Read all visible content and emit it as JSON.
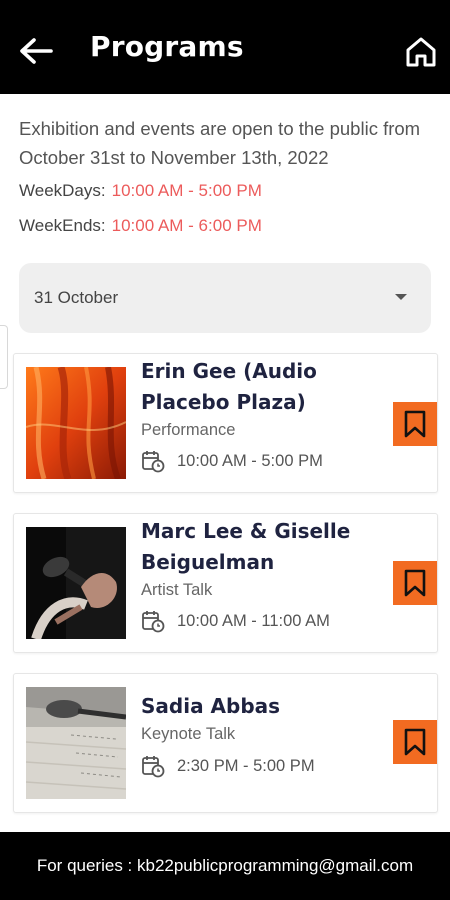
{
  "header": {
    "title": "Programs",
    "back_icon": "arrow-left-icon",
    "home_icon": "home-icon",
    "background": "#000000"
  },
  "intro": {
    "text": "Exhibition and events are open to the public from October 31st to November 13th, 2022",
    "weekdays_label": "WeekDays:",
    "weekdays_hours": "10:00 AM - 5:00 PM",
    "weekends_label": "WeekEnds:",
    "weekends_hours": "10:00 AM - 6:00 PM",
    "hours_color": "#ec5b5b"
  },
  "date_filter": {
    "selected": "31 October",
    "icon": "caret-down-icon"
  },
  "programs": [
    {
      "name": "Erin Gee (Audio Placebo Plaza)",
      "type": "Performance",
      "time": "10:00 AM - 5:00 PM"
    },
    {
      "name": "Marc Lee & Giselle Beiguelman",
      "type": "Artist Talk",
      "time": "10:00 AM - 11:00 AM"
    },
    {
      "name": "Sadia Abbas",
      "type": "Keynote Talk",
      "time": "2:30 PM - 5:00 PM"
    }
  ],
  "accent_color": "#f26b21",
  "footer": {
    "text": "For queries : kb22publicprogramming@gmail.com"
  }
}
